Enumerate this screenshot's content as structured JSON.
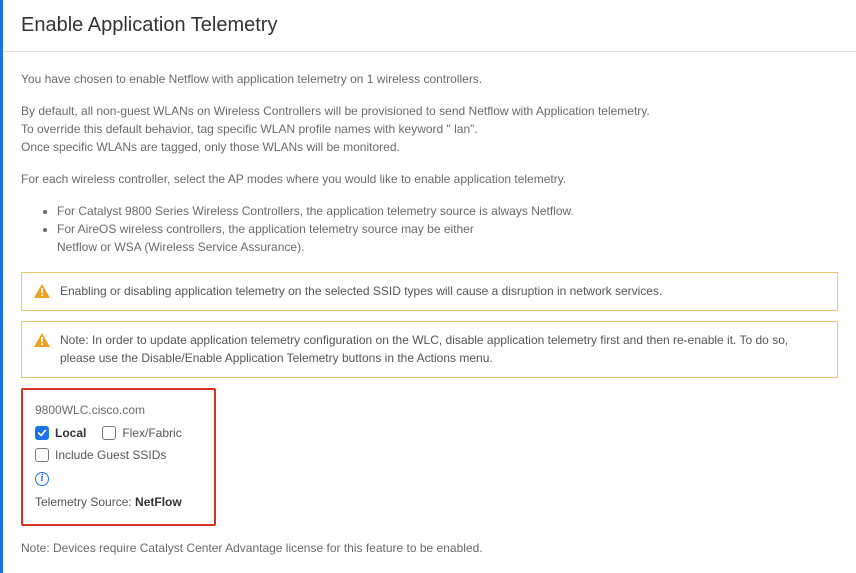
{
  "header": {
    "title": "Enable Application Telemetry"
  },
  "intro": {
    "line1": "You have chosen to enable Netflow with application telemetry on 1 wireless controllers.",
    "line2a": "By default, all non-guest WLANs on Wireless Controllers will be provisioned to send Netflow with Application telemetry.",
    "line2b": "To override this default behavior, tag specific WLAN profile names with keyword \" lan\".",
    "line2c": "Once specific WLANs are tagged, only those WLANs will be monitored.",
    "line3": "For each wireless controller, select the AP modes where you would like to enable application telemetry."
  },
  "bullets": {
    "b1": "For Catalyst 9800 Series Wireless Controllers, the application telemetry source is always Netflow.",
    "b2a": "For AireOS wireless controllers, the application telemetry source may be either",
    "b2b": "Netflow or WSA (Wireless Service Assurance)."
  },
  "alerts": {
    "a1": "Enabling or disabling application telemetry on the selected SSID types will cause a disruption in network services.",
    "a2": "Note: In order to update application telemetry configuration on the WLC, disable application telemetry first and then re-enable it. To do so, please use the Disable/Enable Application Telemetry buttons in the Actions menu."
  },
  "device": {
    "hostname": "9800WLC.cisco.com",
    "local_label": "Local",
    "flex_label": "Flex/Fabric",
    "guest_label": "Include Guest SSIDs",
    "source_label": "Telemetry Source: ",
    "source_value": "NetFlow"
  },
  "footnote": "Note: Devices require Catalyst Center Advantage license for this feature to be enabled."
}
